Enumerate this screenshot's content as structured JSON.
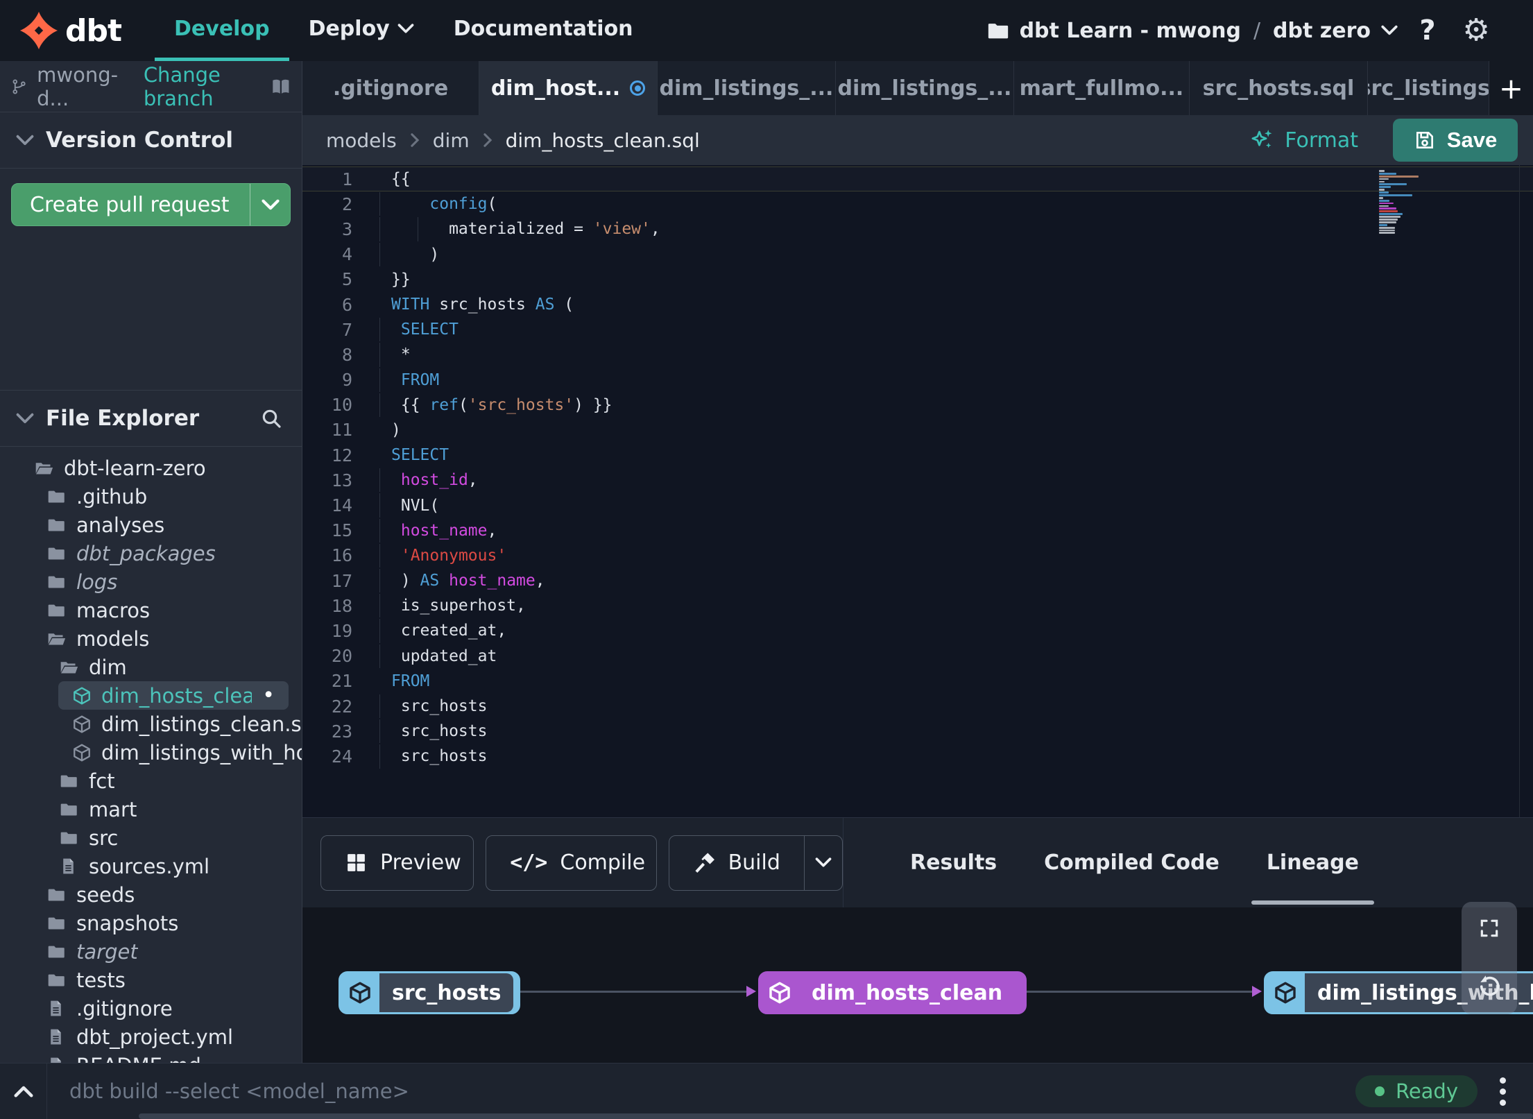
{
  "topbar": {
    "brand": "dbt",
    "nav": [
      {
        "label": "Develop",
        "active": true,
        "chevron": false
      },
      {
        "label": "Deploy",
        "active": false,
        "chevron": true
      },
      {
        "label": "Documentation",
        "active": false,
        "chevron": false
      }
    ],
    "project": {
      "account": "dbt Learn - mwong",
      "separator": "/",
      "name": "dbt zero"
    },
    "help_label": "?"
  },
  "sidebar": {
    "branch": {
      "name": "mwong-d...",
      "change_label": "Change branch"
    },
    "version_control": {
      "title": "Version Control",
      "create_pr_label": "Create pull request"
    },
    "file_explorer": {
      "title": "File Explorer"
    },
    "tree": [
      {
        "name": "dbt-learn-zero",
        "icon": "folder-open",
        "level": 0
      },
      {
        "name": ".github",
        "icon": "folder",
        "level": 1
      },
      {
        "name": "analyses",
        "icon": "folder",
        "level": 1
      },
      {
        "name": "dbt_packages",
        "icon": "folder",
        "level": 1,
        "italic": true
      },
      {
        "name": "logs",
        "icon": "folder",
        "level": 1,
        "italic": true
      },
      {
        "name": "macros",
        "icon": "folder",
        "level": 1
      },
      {
        "name": "models",
        "icon": "folder-open",
        "level": 1
      },
      {
        "name": "dim",
        "icon": "folder-open",
        "level": 2
      },
      {
        "name": "dim_hosts_clean.sql",
        "icon": "model",
        "level": 3,
        "selected": true,
        "modified": true
      },
      {
        "name": "dim_listings_clean.sql",
        "icon": "model",
        "level": 3
      },
      {
        "name": "dim_listings_with_hosts...",
        "icon": "model",
        "level": 3
      },
      {
        "name": "fct",
        "icon": "folder",
        "level": 2
      },
      {
        "name": "mart",
        "icon": "folder",
        "level": 2
      },
      {
        "name": "src",
        "icon": "folder",
        "level": 2
      },
      {
        "name": "sources.yml",
        "icon": "file",
        "level": 2
      },
      {
        "name": "seeds",
        "icon": "folder",
        "level": 1
      },
      {
        "name": "snapshots",
        "icon": "folder",
        "level": 1
      },
      {
        "name": "target",
        "icon": "folder",
        "level": 1,
        "italic": true
      },
      {
        "name": "tests",
        "icon": "folder",
        "level": 1
      },
      {
        "name": ".gitignore",
        "icon": "file",
        "level": 1
      },
      {
        "name": "dbt_project.yml",
        "icon": "file",
        "level": 1
      },
      {
        "name": "README.md",
        "icon": "file",
        "level": 1
      }
    ]
  },
  "tabs": {
    "items": [
      {
        "label": ".gitignore",
        "active": false,
        "modified": false
      },
      {
        "label": "dim_host...",
        "active": true,
        "modified": true
      },
      {
        "label": "dim_listings_...",
        "active": false,
        "modified": false
      },
      {
        "label": "dim_listings_...",
        "active": false,
        "modified": false
      },
      {
        "label": "mart_fullmo...",
        "active": false,
        "modified": false
      },
      {
        "label": "src_hosts.sql",
        "active": false,
        "modified": false
      },
      {
        "label": "src_listings.",
        "active": false,
        "modified": false
      }
    ],
    "add_label": "+"
  },
  "breadcrumb": [
    "models",
    "dim",
    "dim_hosts_clean.sql"
  ],
  "actions": {
    "format_label": "Format",
    "save_label": "Save"
  },
  "editor": {
    "lines": [
      {
        "n": 1,
        "current": true,
        "t": [
          [
            "{{",
            "p"
          ]
        ]
      },
      {
        "n": 2,
        "g": [
          0
        ],
        "t": [
          [
            "    ",
            "p"
          ],
          [
            "config",
            "k"
          ],
          [
            "(",
            "p"
          ]
        ]
      },
      {
        "n": 3,
        "g": [
          0,
          4
        ],
        "t": [
          [
            "      materialized = ",
            "p"
          ],
          [
            "'view'",
            "s"
          ],
          [
            ",",
            "p"
          ]
        ]
      },
      {
        "n": 4,
        "g": [
          0
        ],
        "t": [
          [
            "    )",
            "p"
          ]
        ]
      },
      {
        "n": 5,
        "t": [
          [
            "}}",
            "p"
          ]
        ]
      },
      {
        "n": 6,
        "t": [
          [
            "WITH",
            "k"
          ],
          [
            " src_hosts ",
            "p"
          ],
          [
            "AS",
            "k"
          ],
          [
            " (",
            "p"
          ]
        ]
      },
      {
        "n": 7,
        "g": [
          0
        ],
        "t": [
          [
            " ",
            "p"
          ],
          [
            "SELECT",
            "k"
          ]
        ]
      },
      {
        "n": 8,
        "g": [
          0
        ],
        "t": [
          [
            " *",
            "p"
          ]
        ]
      },
      {
        "n": 9,
        "g": [
          0
        ],
        "t": [
          [
            " ",
            "p"
          ],
          [
            "FROM",
            "k"
          ]
        ]
      },
      {
        "n": 10,
        "g": [
          0
        ],
        "t": [
          [
            " {{ ",
            "p"
          ],
          [
            "ref",
            "k"
          ],
          [
            "(",
            "p"
          ],
          [
            "'src_hosts'",
            "s"
          ],
          [
            ") }}",
            "p"
          ]
        ]
      },
      {
        "n": 11,
        "t": [
          [
            ")",
            "p"
          ]
        ]
      },
      {
        "n": 12,
        "t": [
          [
            "SELECT",
            "k"
          ]
        ]
      },
      {
        "n": 13,
        "g": [
          0
        ],
        "t": [
          [
            " ",
            "p"
          ],
          [
            "host_id",
            "i"
          ],
          [
            ",",
            "p"
          ]
        ]
      },
      {
        "n": 14,
        "g": [
          0
        ],
        "t": [
          [
            " NVL(",
            "p"
          ]
        ]
      },
      {
        "n": 15,
        "g": [
          0
        ],
        "t": [
          [
            " ",
            "p"
          ],
          [
            "host_name",
            "i"
          ],
          [
            ",",
            "p"
          ]
        ]
      },
      {
        "n": 16,
        "g": [
          0
        ],
        "t": [
          [
            " ",
            "p"
          ],
          [
            "'Anonymous'",
            "r"
          ]
        ]
      },
      {
        "n": 17,
        "g": [
          0
        ],
        "t": [
          [
            " ) ",
            "p"
          ],
          [
            "AS",
            "k"
          ],
          [
            " ",
            "p"
          ],
          [
            "host_name",
            "i"
          ],
          [
            ",",
            "p"
          ]
        ]
      },
      {
        "n": 18,
        "g": [
          0
        ],
        "t": [
          [
            " is_superhost,",
            "p"
          ]
        ]
      },
      {
        "n": 19,
        "g": [
          0
        ],
        "t": [
          [
            " created_at,",
            "p"
          ]
        ]
      },
      {
        "n": 20,
        "g": [
          0
        ],
        "t": [
          [
            " updated_at",
            "p"
          ]
        ]
      },
      {
        "n": 21,
        "t": [
          [
            "FROM",
            "k"
          ]
        ]
      },
      {
        "n": 22,
        "g": [
          0
        ],
        "t": [
          [
            " src_hosts",
            "p"
          ]
        ]
      },
      {
        "n": 23,
        "g": [
          0
        ],
        "t": [
          [
            " src_hosts",
            "p"
          ]
        ]
      },
      {
        "n": 24,
        "g": [
          0
        ],
        "t": [
          [
            " src_hosts",
            "p"
          ]
        ]
      }
    ]
  },
  "bottom_panel": {
    "buttons": [
      {
        "label": "Preview",
        "icon": "grid-icon",
        "split": false
      },
      {
        "label": "Compile",
        "icon": "code-icon",
        "split": false
      },
      {
        "label": "Build",
        "icon": "hammer-icon",
        "split": true
      }
    ],
    "tabs": [
      {
        "label": "Results",
        "active": false
      },
      {
        "label": "Compiled Code",
        "active": false
      },
      {
        "label": "Lineage",
        "active": true
      }
    ]
  },
  "lineage": {
    "nodes": [
      {
        "name": "src_hosts",
        "style": "blue"
      },
      {
        "name": "dim_hosts_clean",
        "style": "purple"
      },
      {
        "name": "dim_listings_with_h",
        "style": "blue"
      }
    ]
  },
  "statusbar": {
    "command": "dbt build --select <model_name>",
    "status": "Ready"
  },
  "colors": {
    "accent_teal": "#3ac0b6",
    "create_pr_green": "#4a9e6b",
    "save_teal": "#2e7b71",
    "keyword_blue": "#4f9fd6",
    "string_salmon": "#c78d6e",
    "string_red": "#dd4a44",
    "identifier_magenta": "#d24be0",
    "node_blue": "#7cc3e6",
    "node_purple": "#aa56cf",
    "ready_green": "#5fc894",
    "logo_orange": "#ff6847"
  }
}
